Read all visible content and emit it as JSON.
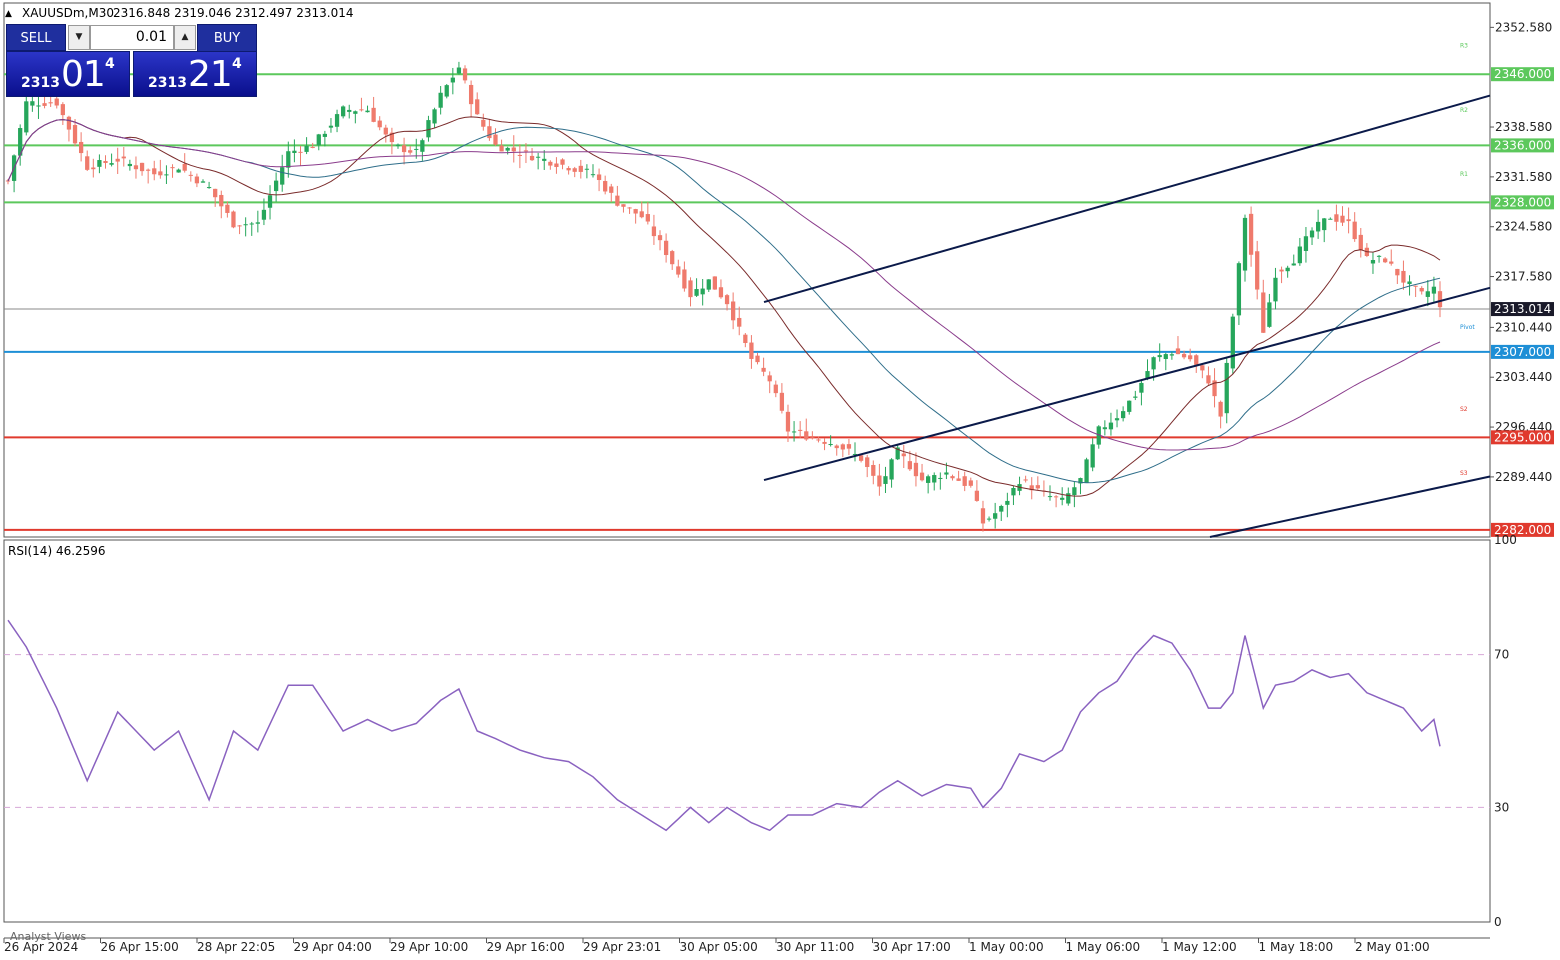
{
  "header": {
    "symbol_line": "XAUUSDm,M30",
    "ohlc": "2316.848 2319.046 2312.497 2313.014",
    "collapse_glyph": "▲"
  },
  "trade_panel": {
    "sell_label": "SELL",
    "buy_label": "BUY",
    "lot": "0.01",
    "sell_price": {
      "big": "2313",
      "pips": "01",
      "frac": "4"
    },
    "buy_price": {
      "big": "2313",
      "pips": "21",
      "frac": "4"
    },
    "down_glyph": "▼",
    "up_glyph": "▲"
  },
  "colors": {
    "bull": "#26a65b",
    "bear": "#ef7a6c",
    "resistance": "#5cc85c",
    "support": "#e03a2e",
    "pivot": "#1e8fd6",
    "channel": "#0b1a4a",
    "rsi": "#8a62c0",
    "ma_fast": "#7a2b2b",
    "ma_mid": "#2f6e8a",
    "ma_slow": "#8a3c8c"
  },
  "chart_data": {
    "type": "candlestick",
    "y_axis_ticks": [
      "2352.580",
      "2338.580",
      "2331.580",
      "2324.580",
      "2317.580",
      "2310.440",
      "2303.440",
      "2296.440",
      "2289.440"
    ],
    "ylim": [
      2281,
      2356
    ],
    "x_ticks": [
      "26 Apr 2024",
      "26 Apr 15:00",
      "28 Apr 22:05",
      "29 Apr 04:00",
      "29 Apr 10:00",
      "29 Apr 16:00",
      "29 Apr 23:01",
      "30 Apr 05:00",
      "30 Apr 11:00",
      "30 Apr 17:00",
      "1 May 00:00",
      "1 May 06:00",
      "1 May 12:00",
      "1 May 18:00",
      "2 May 01:00"
    ],
    "current_price": "2313.014",
    "horizontal_levels": [
      {
        "label": "2346.000",
        "price": 2346,
        "kind": "resistance"
      },
      {
        "label": "2336.000",
        "price": 2336,
        "kind": "resistance"
      },
      {
        "label": "2328.000",
        "price": 2328,
        "kind": "resistance"
      },
      {
        "label": "2307.000",
        "price": 2307,
        "kind": "pivot"
      },
      {
        "label": "2295.000",
        "price": 2295,
        "kind": "support"
      },
      {
        "label": "2282.000",
        "price": 2282,
        "kind": "support"
      }
    ],
    "pivot_labels": [
      "R3",
      "R2",
      "R1",
      "Pivot",
      "S2",
      "S3"
    ],
    "close_anchors": [
      [
        0,
        2331
      ],
      [
        3,
        2342
      ],
      [
        8,
        2342
      ],
      [
        13,
        2333
      ],
      [
        18,
        2334
      ],
      [
        24,
        2332
      ],
      [
        28,
        2333
      ],
      [
        33,
        2330
      ],
      [
        37,
        2325
      ],
      [
        41,
        2325
      ],
      [
        46,
        2335
      ],
      [
        50,
        2336
      ],
      [
        55,
        2341
      ],
      [
        59,
        2341
      ],
      [
        63,
        2336
      ],
      [
        67,
        2335
      ],
      [
        71,
        2343
      ],
      [
        74,
        2347
      ],
      [
        77,
        2340
      ],
      [
        80,
        2336
      ],
      [
        84,
        2335
      ],
      [
        88,
        2334
      ],
      [
        92,
        2333
      ],
      [
        96,
        2332
      ],
      [
        100,
        2328
      ],
      [
        104,
        2326
      ],
      [
        108,
        2321
      ],
      [
        112,
        2315
      ],
      [
        115,
        2317
      ],
      [
        118,
        2314
      ],
      [
        120,
        2310
      ],
      [
        122,
        2306
      ],
      [
        125,
        2303
      ],
      [
        128,
        2296
      ],
      [
        132,
        2295
      ],
      [
        136,
        2294
      ],
      [
        140,
        2292
      ],
      [
        143,
        2288
      ],
      [
        146,
        2293
      ],
      [
        150,
        2289
      ],
      [
        154,
        2290
      ],
      [
        158,
        2288
      ],
      [
        160,
        2283
      ],
      [
        163,
        2285
      ],
      [
        166,
        2289
      ],
      [
        170,
        2287
      ],
      [
        173,
        2286
      ],
      [
        176,
        2289
      ],
      [
        179,
        2296
      ],
      [
        182,
        2298
      ],
      [
        185,
        2301
      ],
      [
        188,
        2306
      ],
      [
        191,
        2307
      ],
      [
        194,
        2306
      ],
      [
        197,
        2303
      ],
      [
        199,
        2298
      ],
      [
        201,
        2312
      ],
      [
        203,
        2326
      ],
      [
        206,
        2310
      ],
      [
        208,
        2318
      ],
      [
        211,
        2320
      ],
      [
        214,
        2324
      ],
      [
        217,
        2326
      ],
      [
        220,
        2325
      ],
      [
        223,
        2320
      ],
      [
        226,
        2320
      ],
      [
        229,
        2317
      ],
      [
        232,
        2315
      ],
      [
        234,
        2316
      ],
      [
        235,
        2313
      ]
    ],
    "indicator": {
      "name": "RSI(14)",
      "value": "46.2596",
      "label": "RSI(14) 46.2596",
      "levels": [
        70,
        30
      ],
      "ylim": [
        0,
        100
      ],
      "tick_labels": [
        "100",
        "70",
        "30",
        "0"
      ],
      "anchors": [
        [
          0,
          79
        ],
        [
          3,
          72
        ],
        [
          8,
          56
        ],
        [
          13,
          37
        ],
        [
          18,
          55
        ],
        [
          24,
          45
        ],
        [
          28,
          50
        ],
        [
          33,
          32
        ],
        [
          37,
          50
        ],
        [
          41,
          45
        ],
        [
          46,
          62
        ],
        [
          50,
          62
        ],
        [
          55,
          50
        ],
        [
          59,
          53
        ],
        [
          63,
          50
        ],
        [
          67,
          52
        ],
        [
          71,
          58
        ],
        [
          74,
          61
        ],
        [
          77,
          50
        ],
        [
          80,
          48
        ],
        [
          84,
          45
        ],
        [
          88,
          43
        ],
        [
          92,
          42
        ],
        [
          96,
          38
        ],
        [
          100,
          32
        ],
        [
          104,
          28
        ],
        [
          108,
          24
        ],
        [
          112,
          30
        ],
        [
          115,
          26
        ],
        [
          118,
          30
        ],
        [
          120,
          28
        ],
        [
          122,
          26
        ],
        [
          125,
          24
        ],
        [
          128,
          28
        ],
        [
          132,
          28
        ],
        [
          136,
          31
        ],
        [
          140,
          30
        ],
        [
          143,
          34
        ],
        [
          146,
          37
        ],
        [
          150,
          33
        ],
        [
          154,
          36
        ],
        [
          158,
          35
        ],
        [
          160,
          30
        ],
        [
          163,
          35
        ],
        [
          166,
          44
        ],
        [
          170,
          42
        ],
        [
          173,
          45
        ],
        [
          176,
          55
        ],
        [
          179,
          60
        ],
        [
          182,
          63
        ],
        [
          185,
          70
        ],
        [
          188,
          75
        ],
        [
          191,
          73
        ],
        [
          194,
          66
        ],
        [
          197,
          56
        ],
        [
          199,
          56
        ],
        [
          201,
          60
        ],
        [
          203,
          75
        ],
        [
          206,
          56
        ],
        [
          208,
          62
        ],
        [
          211,
          63
        ],
        [
          214,
          66
        ],
        [
          217,
          64
        ],
        [
          220,
          65
        ],
        [
          223,
          60
        ],
        [
          226,
          58
        ],
        [
          229,
          56
        ],
        [
          232,
          50
        ],
        [
          234,
          53
        ],
        [
          235,
          46
        ]
      ]
    }
  },
  "footer": {
    "watermark": "Analyst Views"
  }
}
